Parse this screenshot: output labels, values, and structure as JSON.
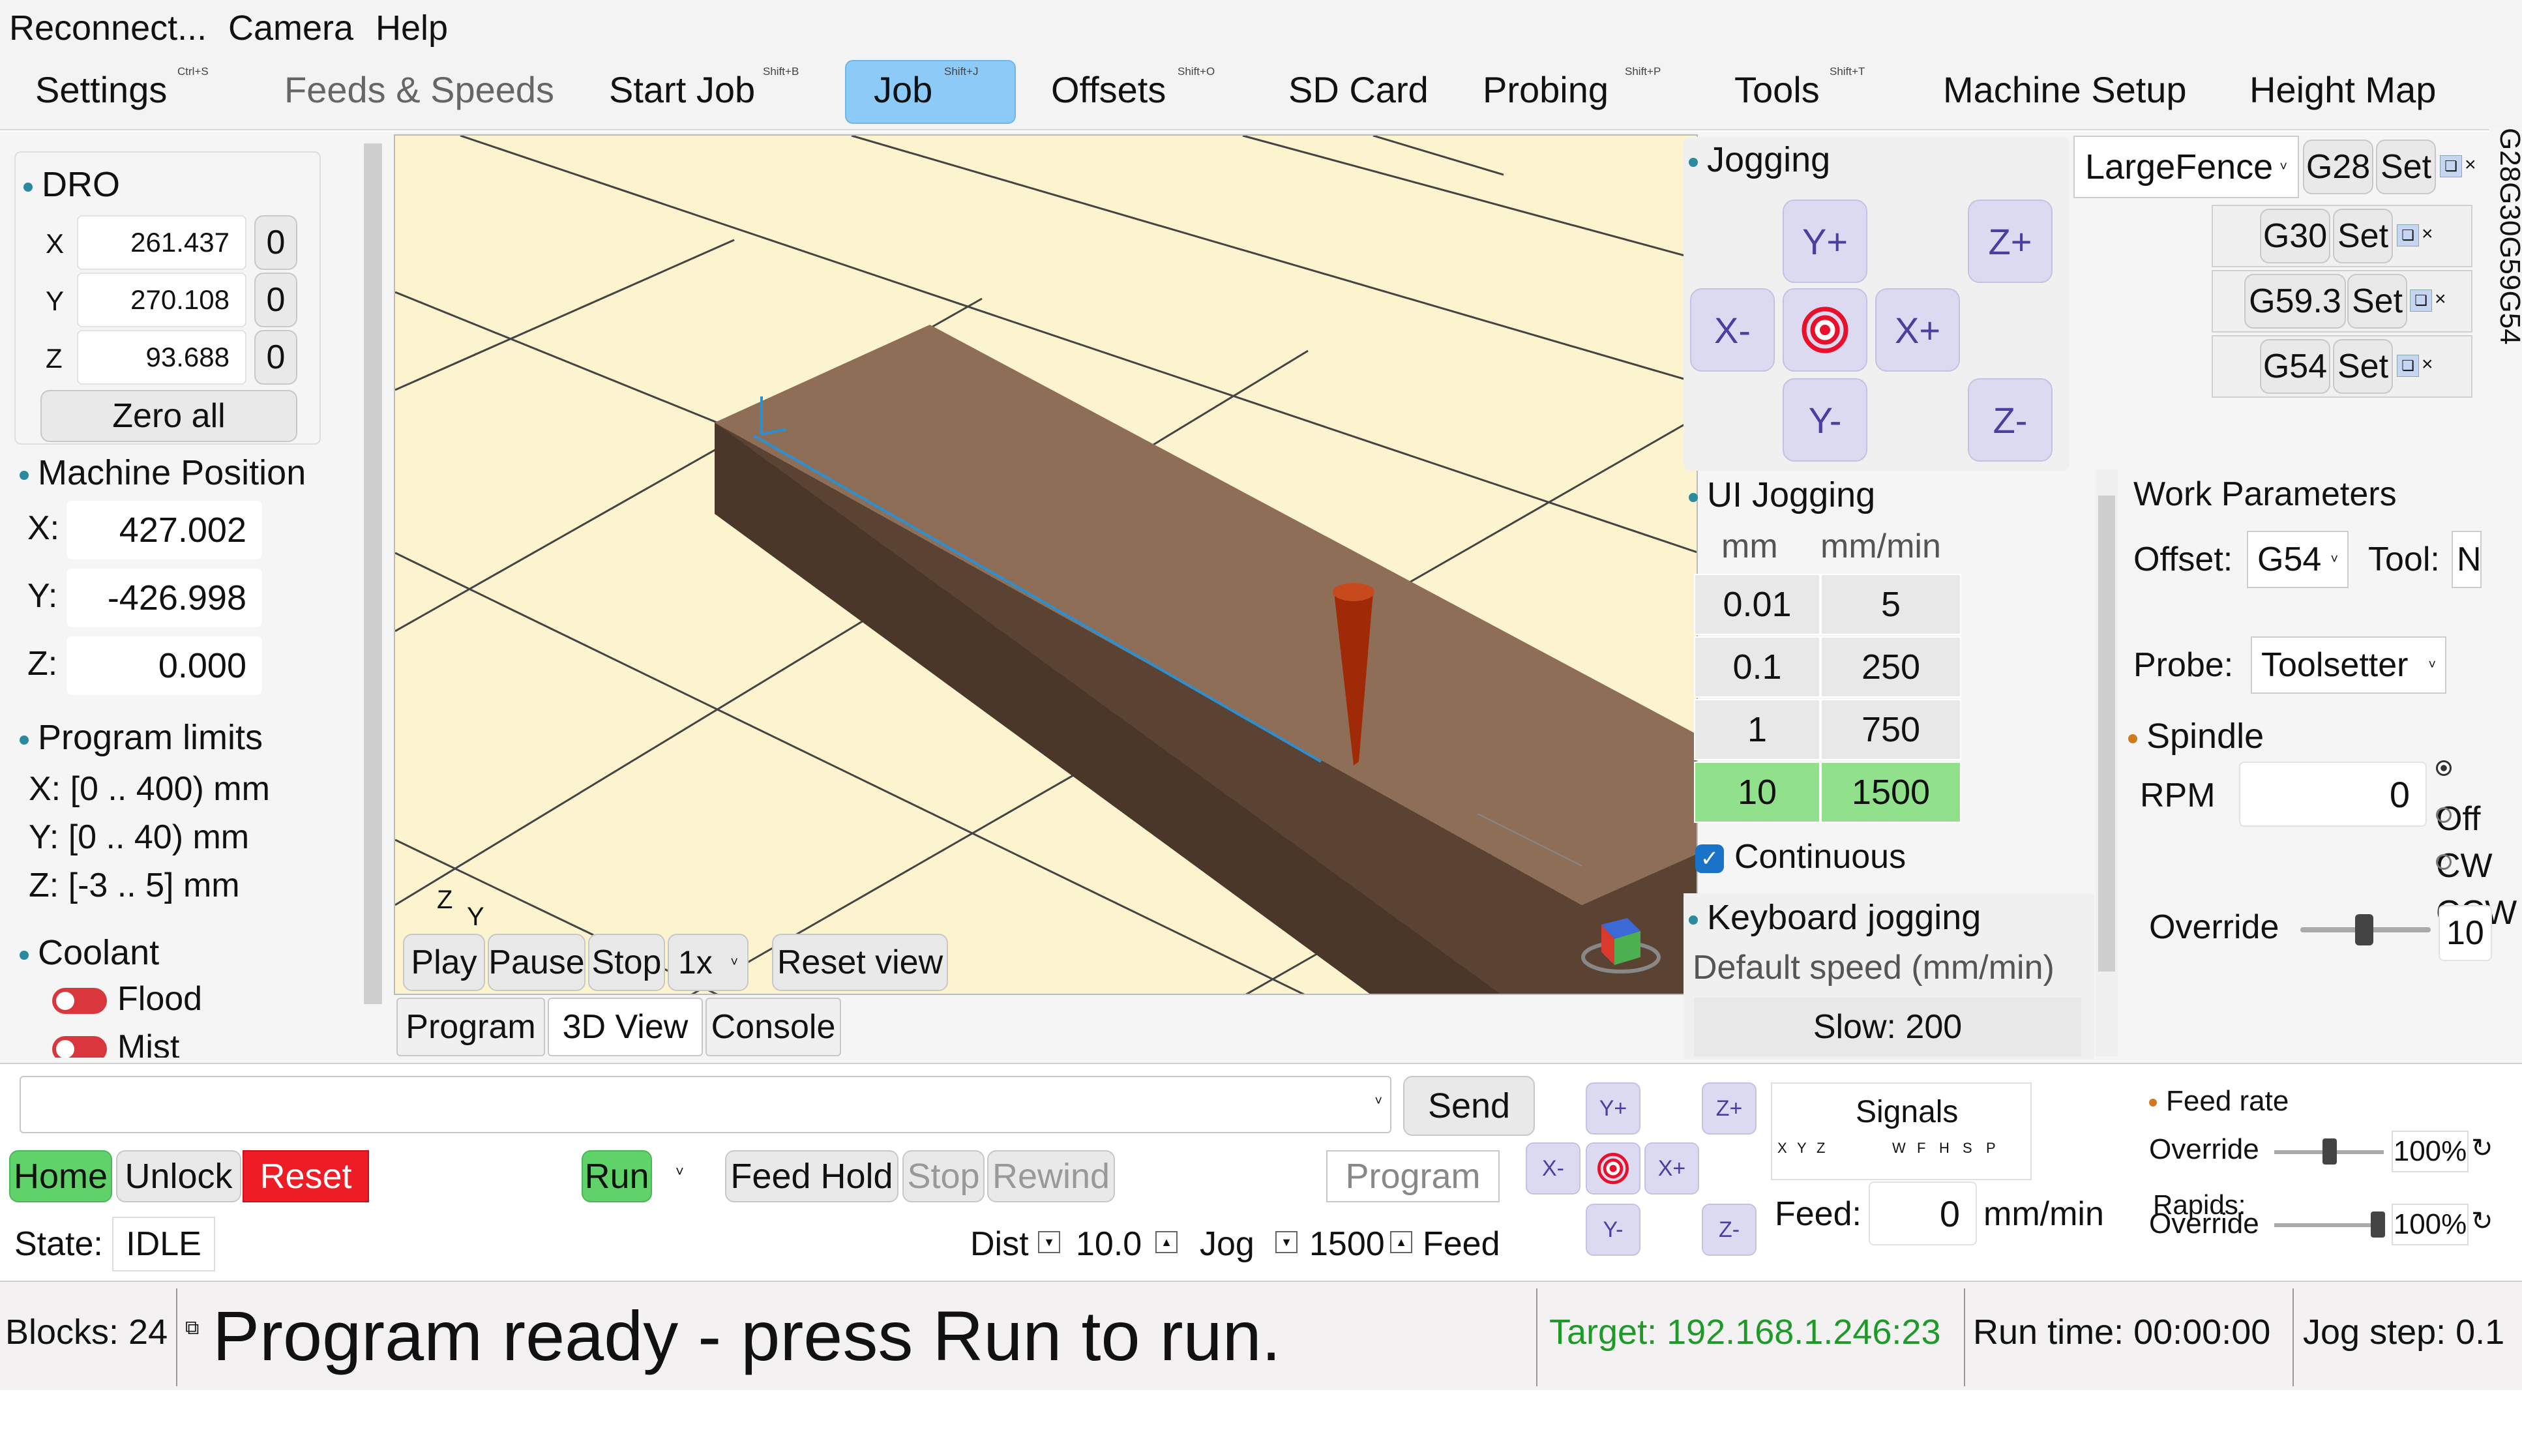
{
  "menu": [
    "Reconnect...",
    "Camera",
    "Help"
  ],
  "tabs": [
    {
      "label": "Settings",
      "shortcut": "Ctrl+S"
    },
    {
      "label": "Feeds & Speeds",
      "shortcut": ""
    },
    {
      "label": "Start Job",
      "shortcut": "Shift+B"
    },
    {
      "label": "Job",
      "shortcut": "Shift+J"
    },
    {
      "label": "Offsets",
      "shortcut": "Shift+O"
    },
    {
      "label": "SD Card",
      "shortcut": ""
    },
    {
      "label": "Probing",
      "shortcut": "Shift+P"
    },
    {
      "label": "Tools",
      "shortcut": "Shift+T"
    },
    {
      "label": "Machine Setup",
      "shortcut": ""
    },
    {
      "label": "Height Map",
      "shortcut": ""
    }
  ],
  "dro": {
    "title": "DRO",
    "rows": [
      {
        "axis": "X",
        "value": "261.437",
        "zero": "0"
      },
      {
        "axis": "Y",
        "value": "270.108",
        "zero": "0"
      },
      {
        "axis": "Z",
        "value": "93.688",
        "zero": "0"
      }
    ],
    "zero_all": "Zero all"
  },
  "machine_position": {
    "title": "Machine Position",
    "rows": [
      {
        "axis": "X:",
        "value": "427.002"
      },
      {
        "axis": "Y:",
        "value": "-426.998"
      },
      {
        "axis": "Z:",
        "value": "0.000"
      }
    ]
  },
  "program_limits": {
    "title": "Program limits",
    "lines": [
      "X: [0 .. 400) mm",
      "Y: [0 .. 40) mm",
      "Z: [-3 .. 5] mm"
    ]
  },
  "coolant": {
    "title": "Coolant",
    "flood": "Flood",
    "mist": "Mist"
  },
  "viewer": {
    "axis_z": "Z",
    "axis_y": "Y",
    "play": "Play",
    "pause": "Pause",
    "stop": "Stop",
    "speed": "1x",
    "reset_view": "Reset view",
    "bottom_tabs": [
      "Program",
      "3D View",
      "Console"
    ]
  },
  "jogging": {
    "title": "Jogging",
    "yplus": "Y+",
    "yminus": "Y-",
    "xplus": "X+",
    "xminus": "X-",
    "zplus": "Z+",
    "zminus": "Z-"
  },
  "offsets_panel": {
    "dropdown": "LargeFence",
    "rows": [
      {
        "code": "G28",
        "set": "Set"
      },
      {
        "code": "G30",
        "set": "Set"
      },
      {
        "code": "G59.3",
        "set": "Set"
      },
      {
        "code": "G54",
        "set": "Set"
      }
    ],
    "side_tabs": "G28G30G59G54"
  },
  "ui_jogging": {
    "title": "UI Jogging",
    "headers": [
      "mm",
      "mm/min"
    ],
    "rows": [
      [
        "0.01",
        "5"
      ],
      [
        "0.1",
        "250"
      ],
      [
        "1",
        "750"
      ],
      [
        "10",
        "1500"
      ]
    ],
    "selected_row": 3,
    "continuous": "Continuous"
  },
  "keyboard_jogging": {
    "title": "Keyboard jogging",
    "subtitle": "Default speed (mm/min)",
    "slow": "Slow:  200"
  },
  "work_parameters": {
    "title": "Work Parameters",
    "offset_label": "Offset:",
    "offset_value": "G54",
    "tool_label": "Tool:",
    "tool_value": "N",
    "probe_label": "Probe:",
    "probe_value": "Toolsetter"
  },
  "spindle": {
    "title": "Spindle",
    "rpm_label": "RPM",
    "rpm_value": "0",
    "options": [
      "Off",
      "CW",
      "CCW"
    ],
    "override_label": "Override",
    "override_value": "10"
  },
  "command": {
    "placeholder": "",
    "send": "Send",
    "home": "Home",
    "unlock": "Unlock",
    "reset": "Reset",
    "run": "Run",
    "feed_hold": "Feed Hold",
    "stop": "Stop",
    "rewind": "Rewind",
    "program": "Program",
    "state_label": "State:",
    "state_value": "IDLE",
    "dist_label": "Dist",
    "dist_value": "10.0",
    "jog_label": "Jog",
    "jog_value": "1500",
    "feed_label": "Feed"
  },
  "mini_jog": {
    "yplus": "Y+",
    "yminus": "Y-",
    "xplus": "X+",
    "xminus": "X-",
    "zplus": "Z+",
    "zminus": "Z-"
  },
  "signals": {
    "title": "Signals",
    "letters": [
      "X",
      "Y",
      "Z",
      "W",
      "F",
      "H",
      "S",
      "P"
    ],
    "feed_label": "Feed:",
    "feed_value": "0",
    "feed_unit": "mm/min"
  },
  "feed_rate": {
    "title": "Feed rate",
    "override_label": "Override",
    "override_value": "100%",
    "rapids_label_1": "Rapids:",
    "rapids_label_2": "Override",
    "rapids_value": "100%"
  },
  "status_bar": {
    "blocks": "Blocks: 24",
    "message": "Program ready - press Run to run.",
    "target": "Target: 192.168.1.246:23",
    "run_time": "Run time: 00:00:00",
    "jog_step": "Jog step: 0.1"
  },
  "colors": {
    "accent_tab": "#8ccaf7",
    "run_green": "#5fd36a",
    "reset_red": "#ee1c24",
    "target_green": "#1f9a2a",
    "jog_purple": "#dcdaf0"
  }
}
